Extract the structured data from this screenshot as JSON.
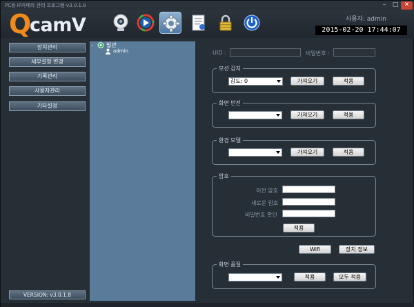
{
  "window": {
    "title": "PC용 IP카메라 관리 프로그램-v3.0.1.8",
    "controls": {
      "minimize": "–",
      "maximize": "□",
      "close": "✕"
    }
  },
  "header": {
    "logo_q": "Q",
    "logo_rest": "camV",
    "user_text": "사용자: admin",
    "datetime": "2015-02-20  17:44:07",
    "toolbar": [
      "webcam-icon",
      "play-icon",
      "settings-gear-icon",
      "document-icon",
      "lock-icon",
      "power-icon"
    ],
    "active_tool": "settings-gear-icon"
  },
  "sidebar": {
    "items": [
      "장치관리",
      "세부설정 변경",
      "기록관리",
      "사용자관리",
      "기타설정"
    ],
    "version": "VERSION: v3.0.1.8"
  },
  "tree": {
    "toggle": "-",
    "root_label": "빌관",
    "child_label": "admin"
  },
  "settings": {
    "uid_label": "UID :",
    "password_label": "비밀번호 :",
    "motion": {
      "title": "모션 감지",
      "select_value": "감도: 0",
      "get_button": "가져오기",
      "apply_button": "적용"
    },
    "flip": {
      "title": "화면 반전",
      "select_value": "",
      "get_button": "가져오기",
      "apply_button": "적용"
    },
    "environment": {
      "title": "환경 모델",
      "select_value": "",
      "get_button": "가져오기",
      "apply_button": "적용"
    },
    "password": {
      "title": "암호",
      "old_label": "이전 암호",
      "new_label": "새로운 암호",
      "confirm_label": "비밀번호 확인",
      "apply_button": "적용"
    },
    "wifi_button": "Wifi",
    "device_info_button": "장치 정보",
    "quality": {
      "title": "화면 품질",
      "select_value": "",
      "apply_button": "적용",
      "apply_all_button": "모두 적용"
    }
  },
  "colors": {
    "logo_orange": "#f08a1a",
    "tree_panel": "#5b7b9a",
    "close_red": "#c64535",
    "background": "#262e36"
  }
}
